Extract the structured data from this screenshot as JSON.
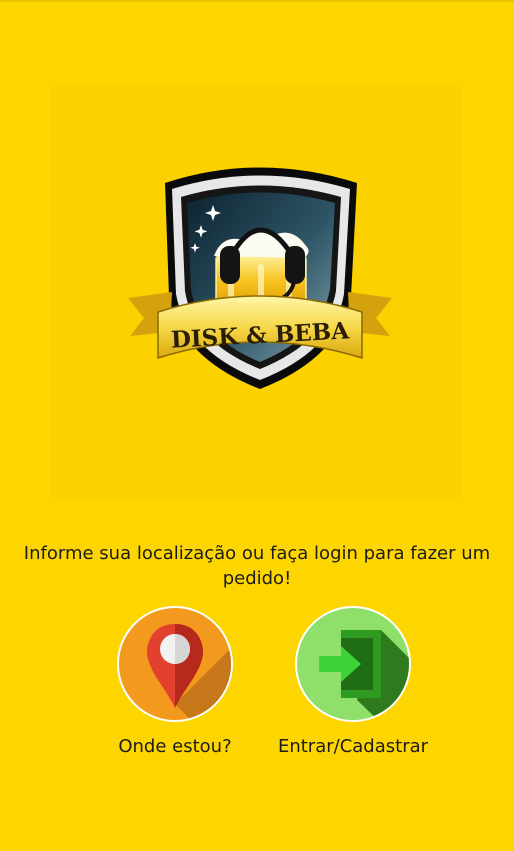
{
  "logo": {
    "brand_text": "DISK & BEBA",
    "icon": "beer-headset-shield-logo"
  },
  "prompt_text": "Informe sua localização ou faça login para fazer um pedido!",
  "actions": [
    {
      "label": "Onde estou?",
      "icon": "location-pin-icon",
      "color": "#F39A1E"
    },
    {
      "label": "Entrar/Cadastrar",
      "icon": "login-arrow-icon",
      "color": "#8EE06A"
    }
  ],
  "colors": {
    "background": "#FDD500",
    "text": "#1c1c1c"
  }
}
